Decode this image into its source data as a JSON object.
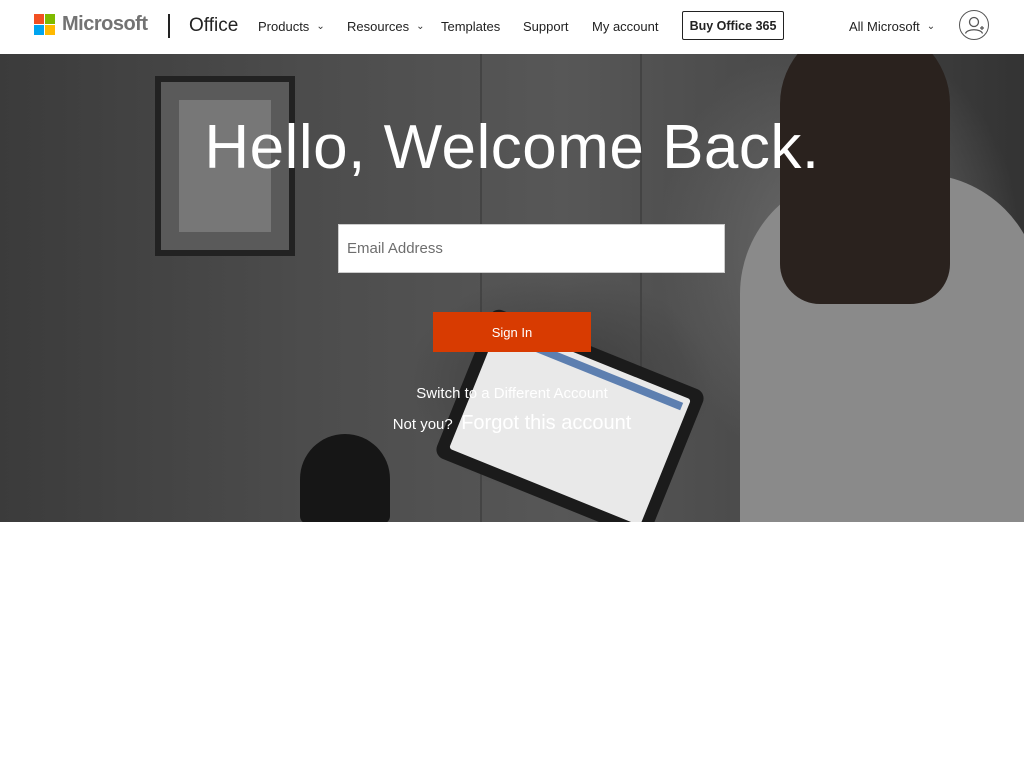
{
  "header": {
    "brand": "Microsoft",
    "product": "Office",
    "nav": [
      {
        "label": "Products",
        "dropdown": true
      },
      {
        "label": "Resources",
        "dropdown": true
      },
      {
        "label": "Templates",
        "dropdown": false
      },
      {
        "label": "Support",
        "dropdown": false
      },
      {
        "label": "My account",
        "dropdown": false
      }
    ],
    "buy_button": "Buy Office 365",
    "all_microsoft": "All Microsoft",
    "icons": [
      "microsoft-logo",
      "chevron-down-icon",
      "account-icon"
    ]
  },
  "hero": {
    "title": "Hello, Welcome Back.",
    "email_placeholder": "Email Address",
    "email_value": "",
    "signin_button": "Sign In",
    "switch_account": "Switch to a Different Account",
    "not_you": "Not you?",
    "forgot_account": "Forgot this account"
  },
  "colors": {
    "accent": "#d83b01",
    "logo_red": "#f25022",
    "logo_green": "#7fba00",
    "logo_blue": "#00a4ef",
    "logo_yellow": "#ffb900"
  }
}
